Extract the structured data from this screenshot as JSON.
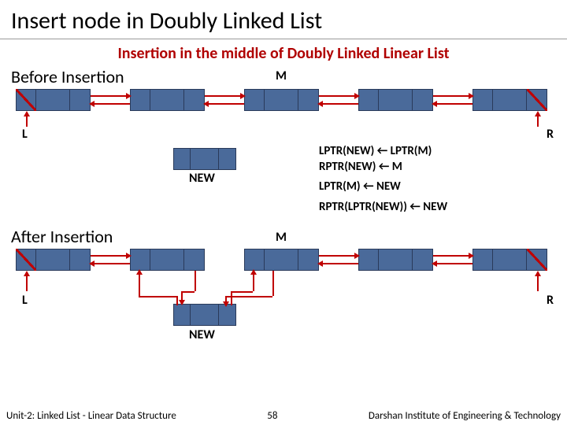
{
  "title": "Insert node in Doubly Linked List",
  "subtitle": "Insertion in the middle of Doubly Linked Linear List",
  "before_heading": "Before Insertion",
  "after_heading": "After Insertion",
  "labels": {
    "L": "L",
    "R": "R",
    "M": "M",
    "NEW": "NEW"
  },
  "ops": {
    "line1": "LPTR(NEW) ← LPTR(M)",
    "line2": "RPTR(NEW) ← M",
    "line3": "LPTR(M) ← NEW",
    "line4": "RPTR(LPTR(NEW)) ← NEW"
  },
  "footer": {
    "left": "Unit-2: Linked List - Linear Data Structure",
    "page": "58",
    "right": "Darshan Institute of Engineering & Technology"
  },
  "chart_data": {
    "type": "diagram",
    "structure": "doubly-linked-list",
    "before": {
      "nodes": [
        "L",
        "node2",
        "M",
        "node4",
        "R"
      ],
      "links": [
        [
          "L",
          "node2",
          "both"
        ],
        [
          "node2",
          "M",
          "both"
        ],
        [
          "M",
          "node4",
          "both"
        ],
        [
          "node4",
          "R",
          "both"
        ]
      ],
      "null_ptrs": [
        "L.lptr",
        "R.rptr"
      ],
      "detached": [
        "NEW"
      ]
    },
    "after": {
      "nodes": [
        "L",
        "node2",
        "M",
        "node4",
        "R",
        "NEW"
      ],
      "links": [
        [
          "L",
          "node2",
          "both"
        ],
        [
          "node2",
          "NEW",
          "both"
        ],
        [
          "NEW",
          "M",
          "both"
        ],
        [
          "M",
          "node4",
          "both"
        ],
        [
          "node4",
          "R",
          "both"
        ]
      ],
      "null_ptrs": [
        "L.lptr",
        "R.rptr"
      ],
      "inserted_between": [
        "node2",
        "M"
      ]
    },
    "operations": [
      "LPTR(NEW) <- LPTR(M)",
      "RPTR(NEW) <- M",
      "LPTR(M) <- NEW",
      "RPTR(LPTR(NEW)) <- NEW"
    ]
  }
}
